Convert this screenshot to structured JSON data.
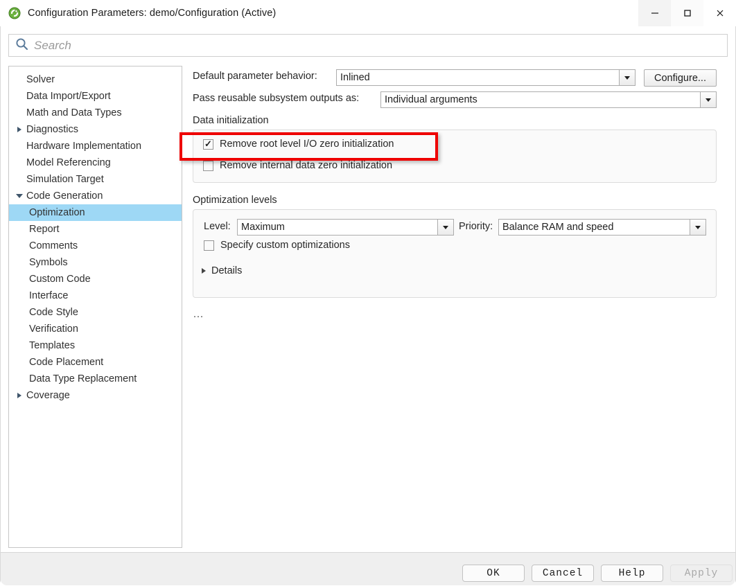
{
  "window": {
    "title": "Configuration Parameters: demo/Configuration (Active)",
    "app_icon": "simulink-icon",
    "minimize_label": "—",
    "maximize_label": "☐",
    "close_label": "✕"
  },
  "search": {
    "icon": "search-icon",
    "placeholder": "Search",
    "value": ""
  },
  "sidebar": {
    "items": [
      {
        "label": "Solver",
        "depth": 0,
        "arrow": "none",
        "selected": false
      },
      {
        "label": "Data Import/Export",
        "depth": 0,
        "arrow": "none",
        "selected": false
      },
      {
        "label": "Math and Data Types",
        "depth": 0,
        "arrow": "none",
        "selected": false
      },
      {
        "label": "Diagnostics",
        "depth": 0,
        "arrow": "collapsed",
        "selected": false
      },
      {
        "label": "Hardware Implementation",
        "depth": 0,
        "arrow": "none",
        "selected": false
      },
      {
        "label": "Model Referencing",
        "depth": 0,
        "arrow": "none",
        "selected": false
      },
      {
        "label": "Simulation Target",
        "depth": 0,
        "arrow": "none",
        "selected": false
      },
      {
        "label": "Code Generation",
        "depth": 0,
        "arrow": "expanded",
        "selected": false
      },
      {
        "label": "Optimization",
        "depth": 1,
        "arrow": "none",
        "selected": true
      },
      {
        "label": "Report",
        "depth": 1,
        "arrow": "none",
        "selected": false
      },
      {
        "label": "Comments",
        "depth": 1,
        "arrow": "none",
        "selected": false
      },
      {
        "label": "Symbols",
        "depth": 1,
        "arrow": "none",
        "selected": false
      },
      {
        "label": "Custom Code",
        "depth": 1,
        "arrow": "none",
        "selected": false
      },
      {
        "label": "Interface",
        "depth": 1,
        "arrow": "none",
        "selected": false
      },
      {
        "label": "Code Style",
        "depth": 1,
        "arrow": "none",
        "selected": false
      },
      {
        "label": "Verification",
        "depth": 1,
        "arrow": "none",
        "selected": false
      },
      {
        "label": "Templates",
        "depth": 1,
        "arrow": "none",
        "selected": false
      },
      {
        "label": "Code Placement",
        "depth": 1,
        "arrow": "none",
        "selected": false
      },
      {
        "label": "Data Type Replacement",
        "depth": 1,
        "arrow": "none",
        "selected": false
      },
      {
        "label": "Coverage",
        "depth": 0,
        "arrow": "collapsed",
        "selected": false
      }
    ]
  },
  "main": {
    "default_parameter_behavior": {
      "label": "Default parameter behavior:",
      "value": "Inlined"
    },
    "configure_button": "Configure...",
    "pass_reusable": {
      "label": "Pass reusable subsystem outputs as:",
      "value": "Individual arguments"
    },
    "data_initialization": {
      "title": "Data initialization",
      "checkboxes": [
        {
          "label": "Remove root level I/O zero initialization",
          "checked": true
        },
        {
          "label": "Remove internal data zero initialization",
          "checked": false
        }
      ]
    },
    "optimization_levels": {
      "title": "Optimization levels",
      "level": {
        "label": "Level:",
        "value": "Maximum"
      },
      "priority": {
        "label": "Priority:",
        "value": "Balance RAM and speed"
      },
      "specify_custom": {
        "label": "Specify custom optimizations",
        "checked": false
      },
      "details": {
        "label": "Details",
        "expanded": false
      }
    },
    "overflow_indicator": "..."
  },
  "footer": {
    "buttons": [
      {
        "label": "OK",
        "enabled": true
      },
      {
        "label": "Cancel",
        "enabled": true
      },
      {
        "label": "Help",
        "enabled": true
      },
      {
        "label": "Apply",
        "enabled": false
      }
    ]
  },
  "colors": {
    "selection": "#9ed8f5",
    "highlight_annotation": "#ee0000",
    "search_icon": "#5a7a9a",
    "panel_bg": "#fafafa"
  }
}
